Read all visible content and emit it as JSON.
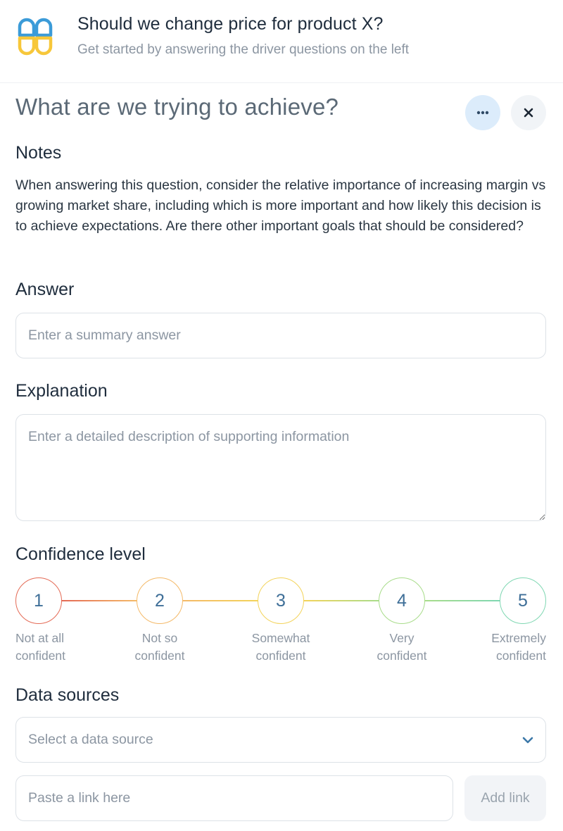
{
  "header": {
    "title": "Should we change price for product X?",
    "subtitle": "Get started by answering the driver questions on the left",
    "logo_icon": "four-leaf-logo-icon",
    "logo_colors": [
      "#3b9bd8",
      "#f7c73a"
    ]
  },
  "panel": {
    "title": "What are we trying to achieve?",
    "more_icon": "ellipsis-icon",
    "close_icon": "close-icon"
  },
  "notes": {
    "label": "Notes",
    "text": "When answering this question, consider the relative importance of increasing margin vs growing market share, including which is more important and how likely this decision is to achieve expectations. Are there other important goals that should be considered?"
  },
  "answer": {
    "label": "Answer",
    "value": "",
    "placeholder": "Enter a summary answer"
  },
  "explanation": {
    "label": "Explanation",
    "value": "",
    "placeholder": "Enter a detailed description of supporting information"
  },
  "confidence": {
    "label": "Confidence level",
    "levels": [
      {
        "number": "1",
        "line1": "Not at all",
        "line2": "confident",
        "color": "#e46a55"
      },
      {
        "number": "2",
        "line1": "Not so",
        "line2": "confident",
        "color": "#f4b968"
      },
      {
        "number": "3",
        "line1": "Somewhat",
        "line2": "confident",
        "color": "#f3d35a"
      },
      {
        "number": "4",
        "line1": "Very",
        "line2": "confident",
        "color": "#a8dc8a"
      },
      {
        "number": "5",
        "line1": "Extremely",
        "line2": "confident",
        "color": "#7fd7b2"
      }
    ],
    "selected": null
  },
  "data_sources": {
    "label": "Data sources",
    "select_placeholder": "Select a data source",
    "select_icon": "chevron-down-icon",
    "link_placeholder": "Paste a link here",
    "link_value": "",
    "add_link_label": "Add link"
  }
}
